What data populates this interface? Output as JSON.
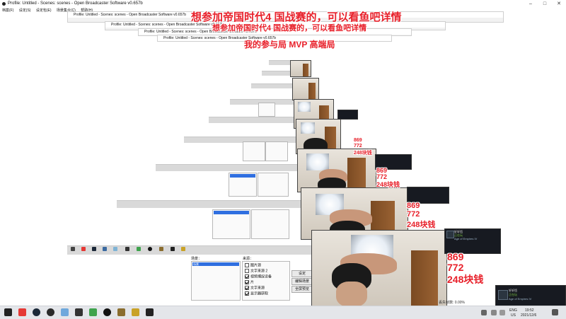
{
  "window": {
    "title": "Profile: Untitled - Scenes: scenes - Open Broadcaster Software v0.657b",
    "menu": [
      "档案(F)",
      "设定(S)",
      "设定包(E)",
      "场景集合(C)",
      "帮助(H)"
    ]
  },
  "overlay": {
    "caption": "想参加帝国时代4 国战赛的，可以看鱼吧详情",
    "caption_echo": "想参加帝国时代4 国战赛的，可以看鱼吧详情",
    "echo_line2": "我的参与局 MVP 高端局",
    "num_a": "869",
    "num_b": "772",
    "num_c": "248块钱"
  },
  "obs": {
    "scenes_label": "场景：",
    "sources_label": "来源：",
    "scene_selected": "场景",
    "sources": [
      {
        "label": "图片源",
        "checked": false
      },
      {
        "label": "文字来源 2",
        "checked": false
      },
      {
        "label": "视频捕捉设备",
        "checked": true
      },
      {
        "label": "片",
        "checked": true
      },
      {
        "label": "文字来源",
        "checked": true
      },
      {
        "label": "显示器获取",
        "checked": true
      }
    ],
    "buttons": [
      "设定",
      "编辑场景",
      "全屏预览"
    ]
  },
  "steam": {
    "name": "轩轩悟",
    "status": "正在玩",
    "game": "Age of Empires IV"
  },
  "status_text": "丢失帧数: 0.00%",
  "tray": {
    "ime_top": "ENG",
    "ime_bottom": "US",
    "time": "19:52",
    "date": "2021/12/6"
  },
  "colors": {
    "accent_red": "#e8202a",
    "selection_blue": "#2f6fe0",
    "steam_bg": "#171a21"
  },
  "taskbar_icons": [
    "start-icon",
    "netease-music-icon",
    "steam-icon",
    "obs-icon",
    "browser-icon",
    "game-icon",
    "green-app-icon",
    "circle-app-icon",
    "aoe-icon",
    "media-icon"
  ]
}
